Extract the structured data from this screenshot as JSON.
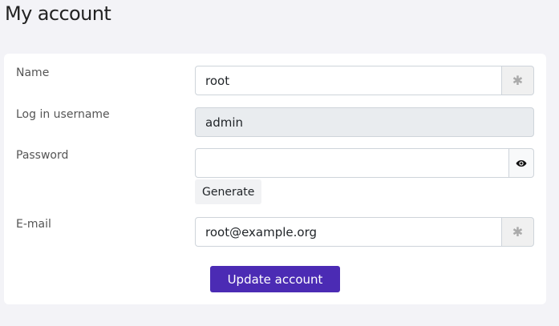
{
  "page": {
    "title": "My account"
  },
  "form": {
    "name": {
      "label": "Name",
      "value": "root",
      "addon_icon": "asterisk-icon"
    },
    "username": {
      "label": "Log in username",
      "value": "admin"
    },
    "password": {
      "label": "Password",
      "value": "",
      "addon_icon": "eye-icon",
      "generate_label": "Generate"
    },
    "email": {
      "label": "E-mail",
      "value": "root@example.org",
      "addon_icon": "asterisk-icon"
    },
    "submit_label": "Update account"
  },
  "colors": {
    "background": "#f3f3f7",
    "card": "#ffffff",
    "primary_button": "#4b2bb4",
    "readonly_input": "#e9ecef"
  }
}
